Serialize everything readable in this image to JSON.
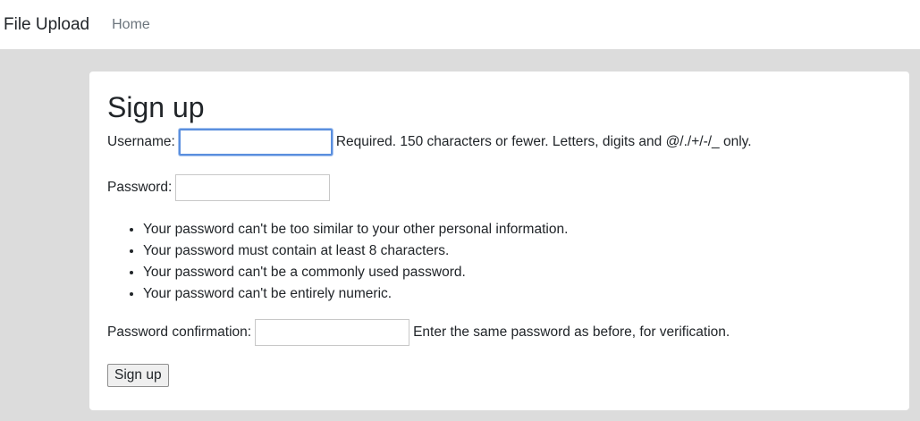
{
  "navbar": {
    "brand": "File Upload",
    "home": "Home"
  },
  "form": {
    "title": "Sign up",
    "username_label": "Username:",
    "username_value": "",
    "username_help": "Required. 150 characters or fewer. Letters, digits and @/./+/-/_ only.",
    "password_label": "Password:",
    "password_value": "",
    "password_rules": [
      "Your password can't be too similar to your other personal information.",
      "Your password must contain at least 8 characters.",
      "Your password can't be a commonly used password.",
      "Your password can't be entirely numeric."
    ],
    "confirm_label": "Password confirmation:",
    "confirm_value": "",
    "confirm_help": "Enter the same password as before, for verification.",
    "submit_label": "Sign up"
  },
  "colors": {
    "page_bg": "#dcdcdc",
    "focus_ring": "#5b8fde"
  }
}
